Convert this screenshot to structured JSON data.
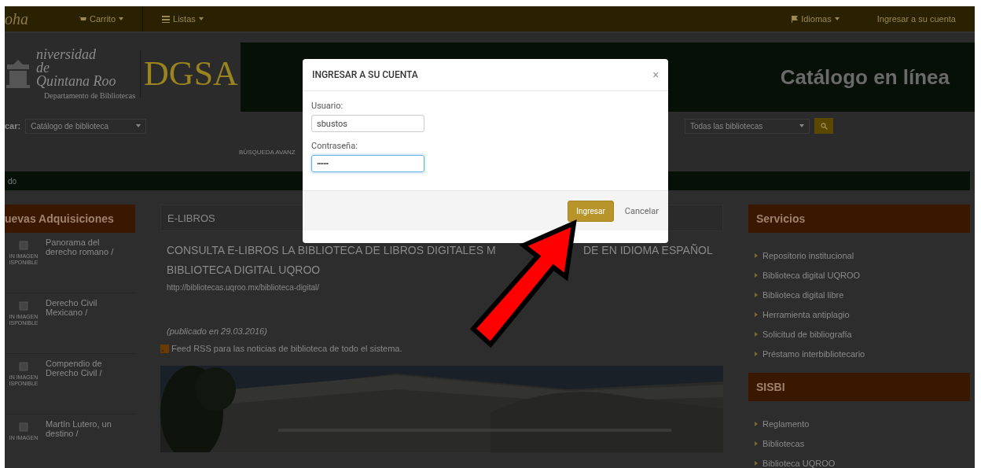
{
  "navbar": {
    "brand": "oha",
    "menus": [
      {
        "label": "Carrito"
      },
      {
        "label": "Listas"
      }
    ],
    "right": [
      {
        "label": "Idiomas"
      },
      {
        "label": "Ingresar a su cuenta"
      }
    ]
  },
  "header": {
    "logo_lines": [
      "niversidad",
      "de",
      "Quintana Roo"
    ],
    "logo_department": "Departamento de Bibliotecas",
    "logo_mark": "DGSA",
    "banner_title": "Catálogo en línea"
  },
  "search": {
    "label": "car:",
    "scope": "Catálogo de biblioteca",
    "library": "Todas las bibliotecas",
    "advanced": "BÚSQUEDA AVANZ"
  },
  "breadcrumb": "do",
  "new_acquisitions": {
    "title": "uevas Adquisiciones",
    "items": [
      {
        "title": "Panorama del derecho romano /",
        "cover": "IN IMAGEN ISPONIBLE"
      },
      {
        "title": "Derecho Civil Mexicano /",
        "cover": "IN IMAGEN ISPONIBLE"
      },
      {
        "title": "Compendio de Derecho Civil /",
        "cover": "IN IMAGEN ISPONIBLE"
      },
      {
        "title": "Martín Lutero, un destino /",
        "cover": "IN IMAGEN"
      }
    ]
  },
  "news": {
    "section": "E-LIBROS",
    "headline_parts": [
      "CONSULTA E-LIBROS LA BIBLIOTECA DE LIBROS DIGITALES M",
      "DE EN IDIOMA ESPAÑOL",
      "BIBLIOTECA DIGITAL UQROO"
    ],
    "link": "http://bibliotecas.uqroo.mx/biblioteca-digital/",
    "date": "(publicado en 29.03.2016)",
    "rss": "Feed RSS para las noticias de biblioteca de todo el sistema.",
    "image": {
      "kind": "picture"
    }
  },
  "services": [
    {
      "title": "Servicios",
      "items": [
        "Repositorio institucional",
        "Biblioteca digital UQROO",
        "Biblioteca digital libre",
        "Herramienta antiplagio",
        "Solicitud de bibliografía",
        "Préstamo interbibliotecario"
      ]
    },
    {
      "title": "SISBI",
      "items": [
        "Reglamento",
        "Bibliotecas",
        "Biblioteca UQROO"
      ]
    }
  ],
  "login_modal": {
    "title": "INGRESAR A SU CUENTA",
    "close": "×",
    "fields": [
      {
        "label": "Usuario:",
        "value": "sbustos",
        "kind": "text",
        "focused": false
      },
      {
        "label": "Contraseña:",
        "value": "•••••••",
        "kind": "password",
        "focused": true
      }
    ],
    "buttons": [
      {
        "label": "Ingresar",
        "kind": "primary"
      },
      {
        "label": "Cancelar",
        "kind": "link"
      }
    ]
  },
  "annotation": {
    "kind": "arrow"
  }
}
